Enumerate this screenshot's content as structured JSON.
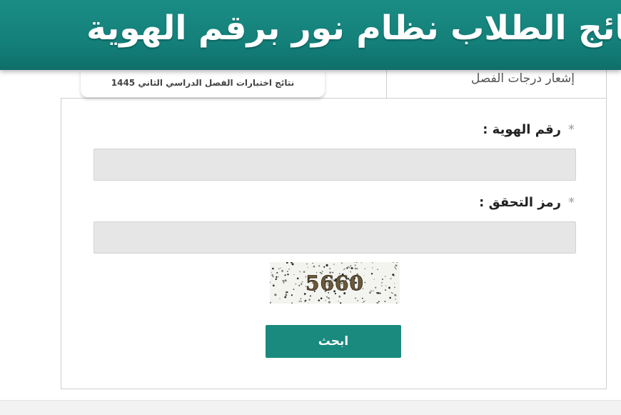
{
  "banner": {
    "title": "نتائج الطلاب نظام نور برقم الهوية"
  },
  "tabs": [
    {
      "label": "إشعار درجات الفصل"
    },
    {
      "label": "نتائج اختبارات الفصل الدراسي الثاني 1445"
    }
  ],
  "form": {
    "id_label": "رقم الهوية :",
    "id_value": "",
    "code_label": "رمز التحقق :",
    "code_value": "",
    "required_mark": "*",
    "captcha_text": "5660",
    "search_label": "ابحث"
  },
  "colors": {
    "brand": "#1a8a7f",
    "input_bg": "#e6e6e6"
  }
}
